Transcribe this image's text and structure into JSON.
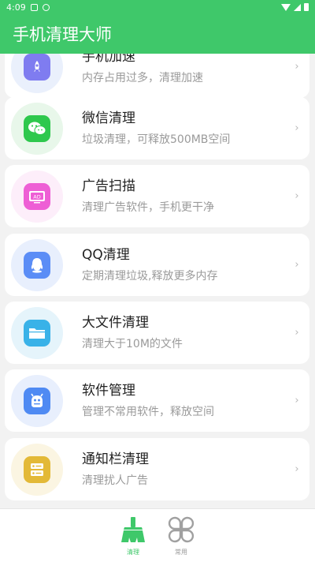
{
  "status": {
    "time": "4:09"
  },
  "app": {
    "title": "手机清理大师"
  },
  "items": [
    {
      "title": "手机加速",
      "subtitle": "内存占用过多，清理加速",
      "icon": "rocket-icon",
      "color": "#7f7cf0",
      "bg": "#eaf0fc"
    },
    {
      "title": "微信清理",
      "subtitle": "垃圾清理，可释放500MB空间",
      "icon": "wechat-icon",
      "color": "#2ec84d",
      "bg": "#e8f7ea"
    },
    {
      "title": "广告扫描",
      "subtitle": "清理广告软件，手机更干净",
      "icon": "ad-icon",
      "color": "#ee5fd5",
      "bg": "#fdeefa"
    },
    {
      "title": "QQ清理",
      "subtitle": "定期清理垃圾,释放更多内存",
      "icon": "qq-icon",
      "color": "#5b8df6",
      "bg": "#e8effd"
    },
    {
      "title": "大文件清理",
      "subtitle": "清理大于10M的文件",
      "icon": "folder-icon",
      "color": "#39b2e8",
      "bg": "#e5f4fb"
    },
    {
      "title": "软件管理",
      "subtitle": "管理不常用软件，释放空间",
      "icon": "android-icon",
      "color": "#4f8af3",
      "bg": "#e8effd"
    },
    {
      "title": "通知栏清理",
      "subtitle": "清理扰人广告",
      "icon": "notification-bar-icon",
      "color": "#e3b937",
      "bg": "#fbf5e2"
    }
  ],
  "tabs": [
    {
      "label": "清理",
      "icon": "broom-icon",
      "color": "#3fc86a",
      "active": true
    },
    {
      "label": "常用",
      "icon": "clover-icon",
      "color": "#999999",
      "active": false
    }
  ]
}
